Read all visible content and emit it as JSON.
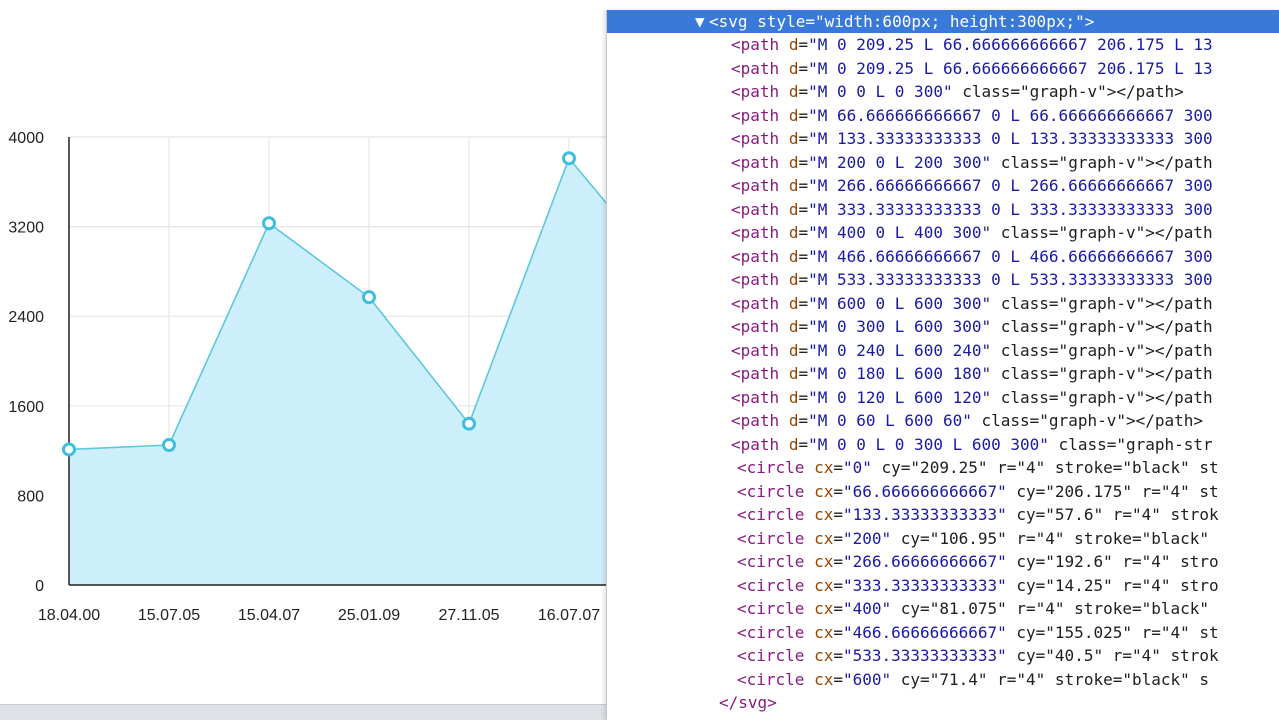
{
  "chart_data": {
    "type": "area",
    "categories": [
      "18.04.00",
      "15.07.05",
      "15.04.07",
      "25.01.09",
      "27.11.05",
      "16.07.07"
    ],
    "values": [
      1210,
      1250,
      3230,
      2570,
      1440,
      3810
    ],
    "y_ticks": [
      "0",
      "800",
      "1600",
      "2400",
      "3200",
      "4000"
    ],
    "ylim": [
      0,
      4000
    ],
    "grid": true,
    "colors": {
      "line": "#5bc8e0",
      "fill": "#cdeffb",
      "point": "#3ebfdc"
    }
  },
  "devtools": {
    "svg_open": {
      "tag": "svg",
      "attr": "style",
      "value": "\"width:600px; height:300px;\""
    },
    "lines": [
      {
        "tag": "path",
        "attr": "d",
        "value": "\"M 0 209.25 L 66.666666666667 206.175 L 13",
        "rest": ""
      },
      {
        "tag": "path",
        "attr": "d",
        "value": "\"M 0 209.25 L 66.666666666667 206.175 L 13",
        "rest": ""
      },
      {
        "tag": "path",
        "attr": "d",
        "value": "\"M 0 0 L 0 300\"",
        "rest": " class=\"graph-v\"></path>"
      },
      {
        "tag": "path",
        "attr": "d",
        "value": "\"M 66.666666666667 0 L 66.666666666667 300",
        "rest": ""
      },
      {
        "tag": "path",
        "attr": "d",
        "value": "\"M 133.33333333333 0 L 133.33333333333 300",
        "rest": ""
      },
      {
        "tag": "path",
        "attr": "d",
        "value": "\"M 200 0 L 200 300\"",
        "rest": " class=\"graph-v\"></path"
      },
      {
        "tag": "path",
        "attr": "d",
        "value": "\"M 266.66666666667 0 L 266.66666666667 300",
        "rest": ""
      },
      {
        "tag": "path",
        "attr": "d",
        "value": "\"M 333.33333333333 0 L 333.33333333333 300",
        "rest": ""
      },
      {
        "tag": "path",
        "attr": "d",
        "value": "\"M 400 0 L 400 300\"",
        "rest": " class=\"graph-v\"></path"
      },
      {
        "tag": "path",
        "attr": "d",
        "value": "\"M 466.66666666667 0 L 466.66666666667 300",
        "rest": ""
      },
      {
        "tag": "path",
        "attr": "d",
        "value": "\"M 533.33333333333 0 L 533.33333333333 300",
        "rest": ""
      },
      {
        "tag": "path",
        "attr": "d",
        "value": "\"M 600 0 L 600 300\"",
        "rest": " class=\"graph-v\"></path"
      },
      {
        "tag": "path",
        "attr": "d",
        "value": "\"M 0 300 L 600 300\"",
        "rest": " class=\"graph-v\"></path"
      },
      {
        "tag": "path",
        "attr": "d",
        "value": "\"M 0 240 L 600 240\"",
        "rest": " class=\"graph-v\"></path"
      },
      {
        "tag": "path",
        "attr": "d",
        "value": "\"M 0 180 L 600 180\"",
        "rest": " class=\"graph-v\"></path"
      },
      {
        "tag": "path",
        "attr": "d",
        "value": "\"M 0 120 L 600 120\"",
        "rest": " class=\"graph-v\"></path"
      },
      {
        "tag": "path",
        "attr": "d",
        "value": "\"M 0 60 L 600 60\"",
        "rest": " class=\"graph-v\"></path>"
      },
      {
        "tag": "path",
        "attr": "d",
        "value": "\"M 0 0 L 0 300 L 600 300\"",
        "rest": " class=\"graph-str"
      },
      {
        "tag": "circle",
        "attr": "cx",
        "value": "\"0\"",
        "rest": " cy=\"209.25\" r=\"4\" stroke=\"black\" st"
      },
      {
        "tag": "circle",
        "attr": "cx",
        "value": "\"66.666666666667\"",
        "rest": " cy=\"206.175\" r=\"4\" st"
      },
      {
        "tag": "circle",
        "attr": "cx",
        "value": "\"133.33333333333\"",
        "rest": " cy=\"57.6\" r=\"4\" strok"
      },
      {
        "tag": "circle",
        "attr": "cx",
        "value": "\"200\"",
        "rest": " cy=\"106.95\" r=\"4\" stroke=\"black\""
      },
      {
        "tag": "circle",
        "attr": "cx",
        "value": "\"266.66666666667\"",
        "rest": " cy=\"192.6\" r=\"4\" stro"
      },
      {
        "tag": "circle",
        "attr": "cx",
        "value": "\"333.33333333333\"",
        "rest": " cy=\"14.25\" r=\"4\" stro"
      },
      {
        "tag": "circle",
        "attr": "cx",
        "value": "\"400\"",
        "rest": " cy=\"81.075\" r=\"4\" stroke=\"black\""
      },
      {
        "tag": "circle",
        "attr": "cx",
        "value": "\"466.66666666667\"",
        "rest": " cy=\"155.025\" r=\"4\" st"
      },
      {
        "tag": "circle",
        "attr": "cx",
        "value": "\"533.33333333333\"",
        "rest": " cy=\"40.5\" r=\"4\" strok"
      },
      {
        "tag": "circle",
        "attr": "cx",
        "value": "\"600\"",
        "rest": " cy=\"71.4\" r=\"4\" stroke=\"black\" s"
      }
    ],
    "svg_close": "</svg>"
  }
}
